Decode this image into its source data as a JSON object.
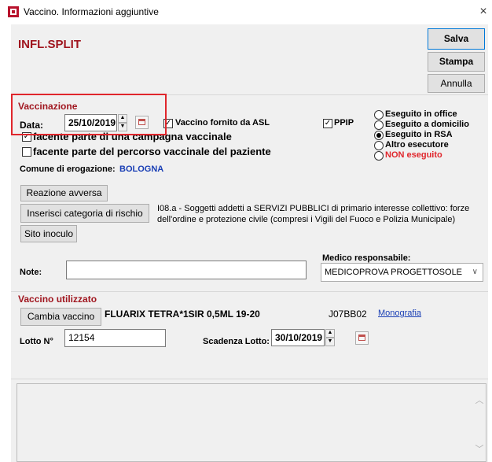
{
  "window": {
    "title": "Vaccino. Informazioni aggiuntive",
    "close": "×"
  },
  "header": {
    "title": "INFL.SPLIT"
  },
  "toolbar": {
    "salva": "Salva",
    "stampa": "Stampa",
    "annulla": "Annulla"
  },
  "vaccinazione": {
    "section_label": "Vaccinazione",
    "date_label": "Data:",
    "date_value": "25/10/2019",
    "asl_checkbox": {
      "label": "Vaccino fornito da ASL",
      "checked": true
    },
    "ppip_checkbox": {
      "label": "PPIP",
      "checked": true
    },
    "campagna_checkbox": {
      "label": "facente parte di una campagna vaccinale",
      "checked": true
    },
    "percorso_checkbox": {
      "label": "facente parte del percorso vaccinale del paziente",
      "checked": false
    },
    "comune_label": "Comune di erogazione:",
    "comune_value": "BOLOGNA",
    "reazione_button": "Reazione avversa ...",
    "categoria_button": "Inserisci categoria di rischio",
    "sito_button": "Sito inoculo",
    "categoria_text": "I08.a - Soggetti addetti a SERVIZI PUBBLICI di primario interesse collettivo: forze dell'ordine e protezione civile (compresi i Vigili del Fuoco e Polizia Municipale)",
    "esecuzione_options": [
      {
        "label": "Eseguito in office",
        "selected": false,
        "color": "#000000"
      },
      {
        "label": "Eseguito a domicilio",
        "selected": false,
        "color": "#000000"
      },
      {
        "label": "Eseguito in RSA",
        "selected": true,
        "color": "#000000"
      },
      {
        "label": "Altro esecutore",
        "selected": false,
        "color": "#000000"
      },
      {
        "label": "NON eseguito",
        "selected": false,
        "color": "#e0262c"
      }
    ],
    "note_label": "Note:",
    "note_value": "",
    "medico_label": "Medico responsabile:",
    "medico_value": "MEDICOPROVA PROGETTOSOLE"
  },
  "vaccino": {
    "section_label": "Vaccino utilizzato",
    "cambia_button": "Cambia vaccino",
    "name": "FLUARIX TETRA*1SIR 0,5ML 19-20",
    "code": "J07BB02",
    "monografia_link": "Monografia",
    "lotto_label": "Lotto N°",
    "lotto_value": "12154",
    "scadenza_label": "Scadenza Lotto:",
    "scadenza_value": "30/10/2019"
  },
  "colors": {
    "accent": "#a0161f",
    "link": "#1a3fb5",
    "highlight_box": "#e0262c",
    "panel_bg": "#f0f0f0"
  }
}
